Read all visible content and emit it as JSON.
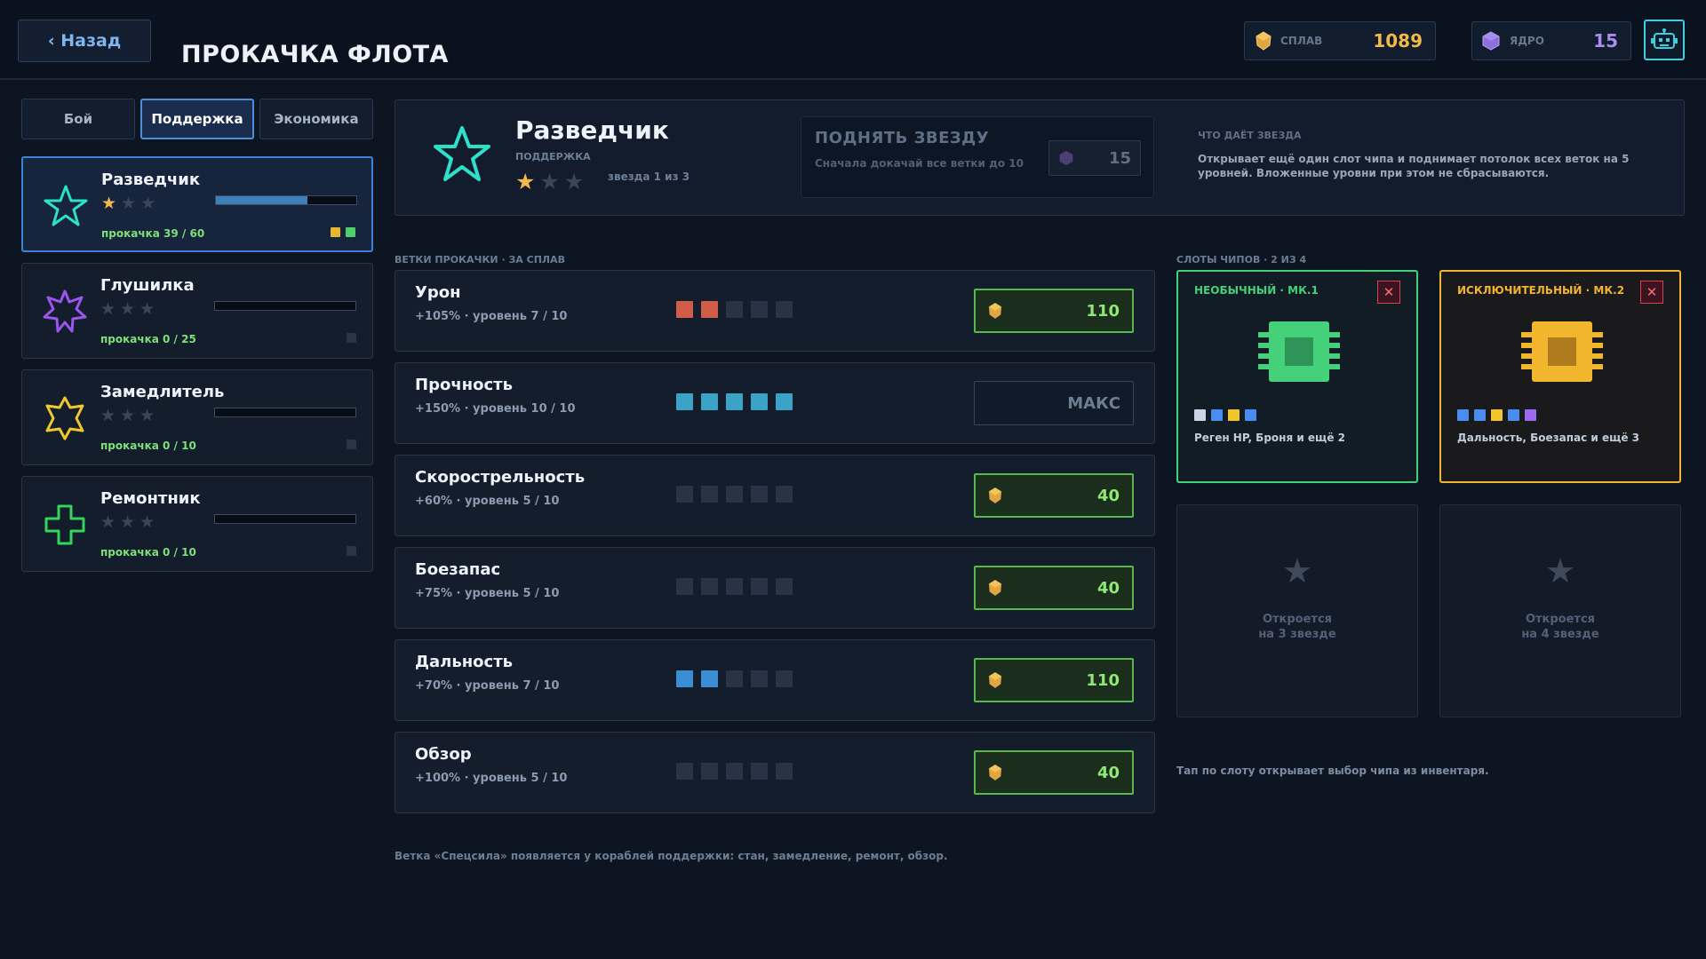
{
  "header": {
    "back_label": "‹ Назад",
    "title": "ПРОКАЧКА ФЛОТА",
    "currencies": [
      {
        "name": "splav",
        "label": "СПЛАВ",
        "value": "1089",
        "icon": "alloy-icon",
        "color": "#f2b94a"
      },
      {
        "name": "core",
        "label": "ЯДРО",
        "value": "15",
        "icon": "core-icon",
        "color": "#a98df0"
      }
    ],
    "robot_icon": "robot-icon"
  },
  "tabs": [
    {
      "label": "Бой",
      "active": false
    },
    {
      "label": "Поддержка",
      "active": true
    },
    {
      "label": "Экономика",
      "active": false
    }
  ],
  "ships": [
    {
      "name": "Разведчик",
      "stars": 1,
      "max_stars": 3,
      "progress_text": "прокачка 39 / 60",
      "progress": 0.65,
      "icon": "star-icon",
      "color": "#2de0c8",
      "selected": true,
      "chip_dots": [
        "#e8b531",
        "#4fd06a"
      ]
    },
    {
      "name": "Глушилка",
      "stars": 0,
      "max_stars": 3,
      "progress_text": "прокачка 0 / 25",
      "progress": 0,
      "icon": "jammer-icon",
      "color": "#9d55f0",
      "selected": false,
      "chip_dots": [
        "#2a3444"
      ]
    },
    {
      "name": "Замедлитель",
      "stars": 0,
      "max_stars": 3,
      "progress_text": "прокачка 0 / 10",
      "progress": 0,
      "icon": "slower-icon",
      "color": "#f0c82a",
      "selected": false,
      "chip_dots": [
        "#2a3444"
      ]
    },
    {
      "name": "Ремонтник",
      "stars": 0,
      "max_stars": 3,
      "progress_text": "прокачка 0 / 10",
      "progress": 0,
      "icon": "repair-cross-icon",
      "color": "#34d45a",
      "selected": false,
      "chip_dots": [
        "#2a3444"
      ]
    }
  ],
  "selected_ship": {
    "name": "Разведчик",
    "role": "ПОДДЕРЖКА",
    "stars": 1,
    "max_stars": 3,
    "stars_text": "звезда 1 из 3",
    "star_up": {
      "title": "ПОДНЯТЬ ЗВЕЗДУ",
      "subtitle": "Сначала докачай все ветки до 10",
      "cost": "15"
    },
    "star_info_label": "ЧТО ДАЁТ ЗВЕЗДА",
    "star_info_text": "Открывает ещё один слот чипа и поднимает потолок всех веток на 5 уровней. Вложенные уровни при этом не сбрасываются."
  },
  "branches_label": "ВЕТКИ ПРОКАЧКИ · ЗА СПЛАВ",
  "branches": [
    {
      "name": "Урон",
      "sub": "+105% · уровень 7 / 10",
      "filled": 2,
      "color": "#d25c4a",
      "cost": "110",
      "max": false
    },
    {
      "name": "Прочность",
      "sub": "+150% · уровень 10 / 10",
      "filled": 5,
      "color": "#3ba3c6",
      "cost": "МАКС",
      "max": true
    },
    {
      "name": "Скорострельность",
      "sub": "+60% · уровень 5 / 10",
      "filled": 0,
      "color": "#3ba3c6",
      "cost": "40",
      "max": false
    },
    {
      "name": "Боезапас",
      "sub": "+75% · уровень 5 / 10",
      "filled": 0,
      "color": "#3ba3c6",
      "cost": "40",
      "max": false
    },
    {
      "name": "Дальность",
      "sub": "+70% · уровень 7 / 10",
      "filled": 2,
      "color": "#3a8fd4",
      "cost": "110",
      "max": false
    },
    {
      "name": "Обзор",
      "sub": "+100% · уровень 5 / 10",
      "filled": 0,
      "color": "#3ba3c6",
      "cost": "40",
      "max": false
    }
  ],
  "chip_slots_label": "СЛОТЫ ЧИПОВ · 2 ИЗ 4",
  "chips": [
    {
      "title": "НЕОБЫЧНЫЙ · МК.1",
      "color": "#45d07a",
      "desc": "Реген HP, Броня и ещё 2",
      "dots": [
        "#c9d4e6",
        "#4a8cf0",
        "#f0c62a",
        "#4a8cf0"
      ],
      "remove_label": "✕"
    },
    {
      "title": "ИСКЛЮЧИТЕЛЬНЫЙ · МК.2",
      "color": "#f2b52e",
      "desc": "Дальность, Боезапас и ещё 3",
      "dots": [
        "#4a8cf0",
        "#4a8cf0",
        "#f0c62a",
        "#4a8cf0",
        "#9b6af0"
      ],
      "remove_label": "✕"
    }
  ],
  "locked_chips": [
    {
      "line1": "Откроется",
      "line2": "на 3 звезде"
    },
    {
      "line1": "Откроется",
      "line2": "на 4 звезде"
    }
  ],
  "chip_hint": "Тап по слоту открывает выбор чипа из инвентаря.",
  "footnote": "Ветка «Спецсила» появляется у кораблей поддержки: стан, замедление, ремонт, обзор."
}
